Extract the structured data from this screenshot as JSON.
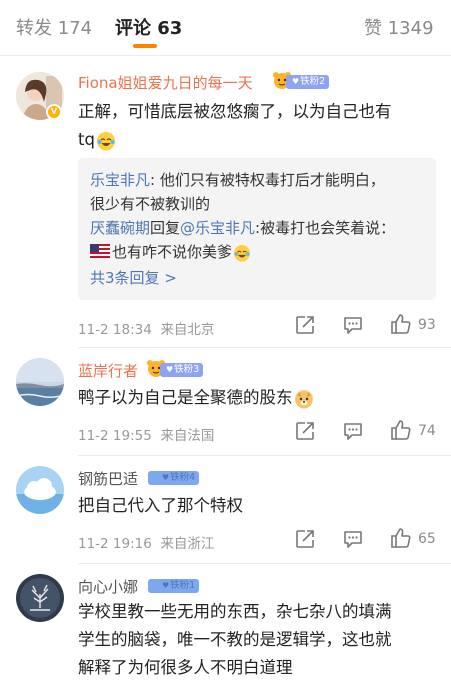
{
  "tabs": {
    "repost_label": "转发 174",
    "comment_label": "评论 63",
    "like_label": "赞 1349"
  },
  "comments": [
    {
      "username": "Fiona姐姐爱九日的每一天",
      "fan_badge": "铁粉2",
      "verified": "V",
      "text_line1": "正解，可惜底层被忽悠瘸了，以为自己也有",
      "text_line2": "tq",
      "replies": [
        {
          "user": "乐宝非凡",
          "text": ": 他们只有被特权毒打后才能明白，",
          "text_cont": "很少有不被教训的"
        },
        {
          "user": "厌蠢碗期",
          "mid": "回复",
          "to": "@乐宝非凡",
          "text": ":被毒打也会笑着说：",
          "text_cont": "也有咋不说你美爹"
        }
      ],
      "more_replies": "共3条回复 >",
      "date": "11-2 18:34",
      "location": "来自北京",
      "likes": "93"
    },
    {
      "username": "蓝岸行者",
      "fan_badge": "铁粉3",
      "text_line1": "鸭子以为自己是全聚德的股东",
      "date": "11-2 19:55",
      "location": "来自法国",
      "likes": "74"
    },
    {
      "username": "钢筋巴适",
      "fan_badge": "铁粉4",
      "text_line1": "把自己代入了那个特权",
      "date": "11-2 19:16",
      "location": "来自浙江",
      "likes": "65"
    },
    {
      "username": "向心小娜",
      "fan_badge": "铁粉1",
      "text_line1": "学校里教一些无用的东西，杂七杂八的填满",
      "text_line2": "学生的脑袋，唯一不教的是逻辑学，这也就",
      "text_line3": "解释了为何很多人不明白道理"
    }
  ],
  "icons": {
    "share": "share-icon",
    "comment": "comment-icon",
    "like": "thumbs-up-icon",
    "fan": "fan-tiger-icon",
    "flag": "us-flag-icon"
  },
  "colors": {
    "accent": "#ff8200",
    "username_orange": "#eb7350",
    "link_blue": "#4e77b2",
    "meta_gray": "#999999"
  }
}
